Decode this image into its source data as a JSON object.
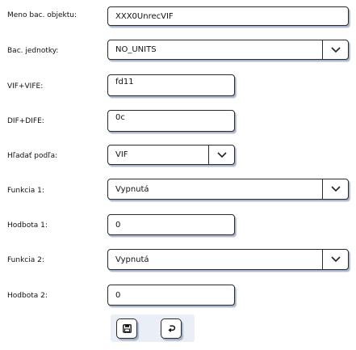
{
  "form": {
    "object_name": {
      "label": "Meno bac. objektu:",
      "value": "XXX0UnrecVIF"
    },
    "units": {
      "label": "Bac. jednotky:",
      "value": "NO_UNITS",
      "icon": "chevron-down-icon"
    },
    "vif_vife": {
      "label": "VIF+VIFE:",
      "value": "fd11"
    },
    "dif_dife": {
      "label": "DIF+DIFE:",
      "value": "0c"
    },
    "search_by": {
      "label": "Hľadať podľa:",
      "value": "VIF",
      "icon": "chevron-down-icon"
    },
    "function1": {
      "label": "Funkcia 1:",
      "value": "Vypnutá",
      "icon": "chevron-down-icon"
    },
    "value1": {
      "label": "Hodbota 1:",
      "value": "0"
    },
    "function2": {
      "label": "Funkcia 2:",
      "value": "Vypnutá",
      "icon": "chevron-down-icon"
    },
    "value2": {
      "label": "Hodbota 2:",
      "value": "0"
    }
  },
  "actions": {
    "save_icon": "save-icon",
    "undo_icon": "undo-icon",
    "accent_color": "#9fb3d6"
  }
}
